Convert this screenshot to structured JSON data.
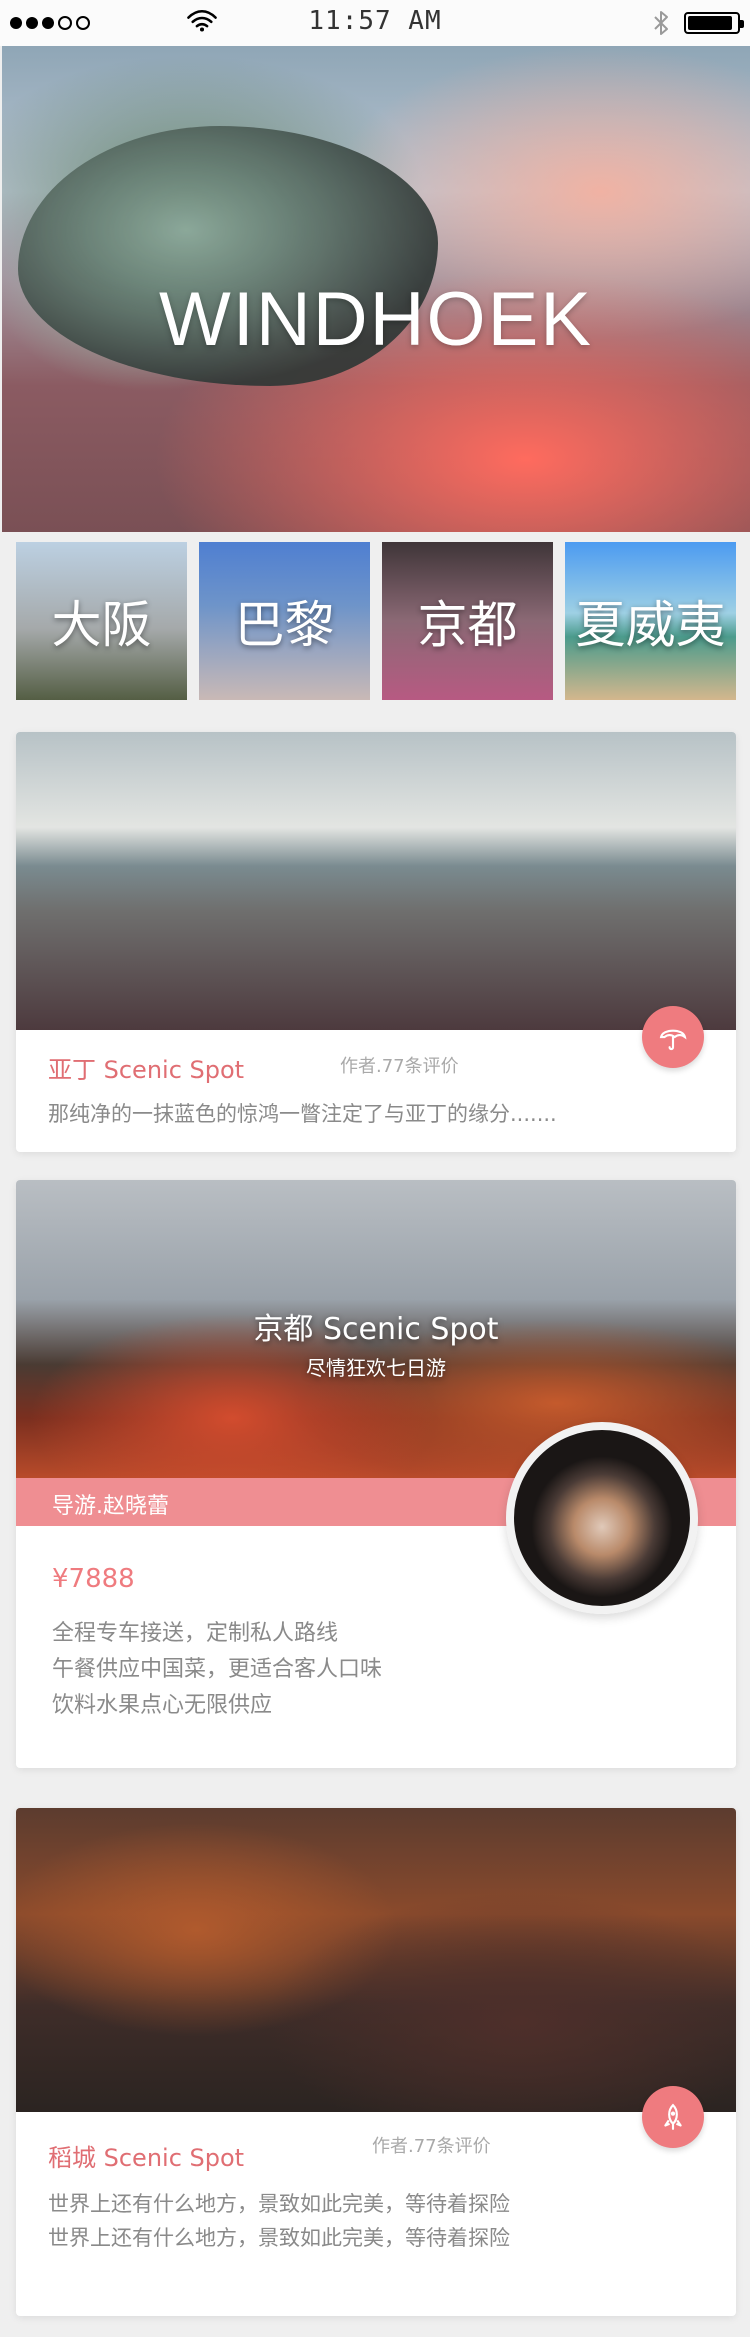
{
  "status_bar": {
    "time": "11:57 AM",
    "signal_dots_filled": 3,
    "signal_dots_empty": 2,
    "icons": [
      "signal-dots-icon",
      "wifi-icon",
      "bluetooth-icon",
      "battery-icon"
    ]
  },
  "hero": {
    "title": "WINDHOEK"
  },
  "cities": [
    {
      "label": "大阪"
    },
    {
      "label": "巴黎"
    },
    {
      "label": "京都"
    },
    {
      "label": "夏威夷"
    }
  ],
  "cards": [
    {
      "title": "亚丁 Scenic Spot",
      "meta": "作者.77条评价",
      "description": "那纯净的一抹蓝色的惊鸿一瞥注定了与亚丁的缘分.......",
      "fab_icon": "umbrella-icon"
    },
    {
      "title": "京都 Scenic Spot",
      "subtitle": "尽情狂欢七日游",
      "guide_label": "导游.赵晓蕾",
      "price": "¥7888",
      "features": [
        "全程专车接送，定制私人路线",
        "午餐供应中国菜，更适合客人口味",
        "饮料水果点心无限供应"
      ]
    },
    {
      "title": "稻城 Scenic Spot",
      "meta": "作者.77条评价",
      "descriptions": [
        "世界上还有什么地方，景致如此完美，等待着探险",
        "世界上还有什么地方，景致如此完美，等待着探险"
      ],
      "fab_icon": "rocket-icon"
    }
  ],
  "colors": {
    "accent": "#ef7b7f",
    "guide_bar": "#ef8e92",
    "title_red": "#e06e73",
    "text_gray": "#8a8a8a",
    "meta_gray": "#a9a9a9",
    "background": "#efefef"
  }
}
